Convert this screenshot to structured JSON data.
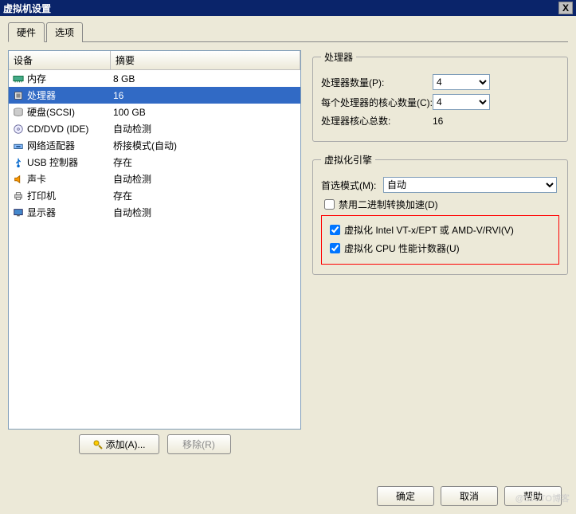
{
  "window": {
    "title": "虚拟机设置",
    "close": "X"
  },
  "tabs": {
    "hardware": "硬件",
    "options": "选项"
  },
  "list": {
    "header_device": "设备",
    "header_summary": "摘要",
    "rows": [
      {
        "name": "内存",
        "summary": "8 GB"
      },
      {
        "name": "处理器",
        "summary": "16"
      },
      {
        "name": "硬盘(SCSI)",
        "summary": "100 GB"
      },
      {
        "name": "CD/DVD (IDE)",
        "summary": "自动检测"
      },
      {
        "name": "网络适配器",
        "summary": "桥接模式(自动)"
      },
      {
        "name": "USB 控制器",
        "summary": "存在"
      },
      {
        "name": "声卡",
        "summary": "自动检测"
      },
      {
        "name": "打印机",
        "summary": "存在"
      },
      {
        "name": "显示器",
        "summary": "自动检测"
      }
    ]
  },
  "buttons": {
    "add": "添加(A)...",
    "remove": "移除(R)"
  },
  "cpu": {
    "legend": "处理器",
    "count_label": "处理器数量(P):",
    "count_value": "4",
    "cores_label": "每个处理器的核心数量(C):",
    "cores_value": "4",
    "total_label": "处理器核心总数:",
    "total_value": "16"
  },
  "virt": {
    "legend": "虚拟化引擎",
    "mode_label": "首选模式(M):",
    "mode_value": "自动",
    "cb_binary": "禁用二进制转换加速(D)",
    "cb_vtx": "虚拟化 Intel VT-x/EPT 或 AMD-V/RVI(V)",
    "cb_counters": "虚拟化 CPU 性能计数器(U)"
  },
  "footer": {
    "ok": "确定",
    "cancel": "取消",
    "help": "帮助"
  },
  "watermark": "@51CTO博客"
}
